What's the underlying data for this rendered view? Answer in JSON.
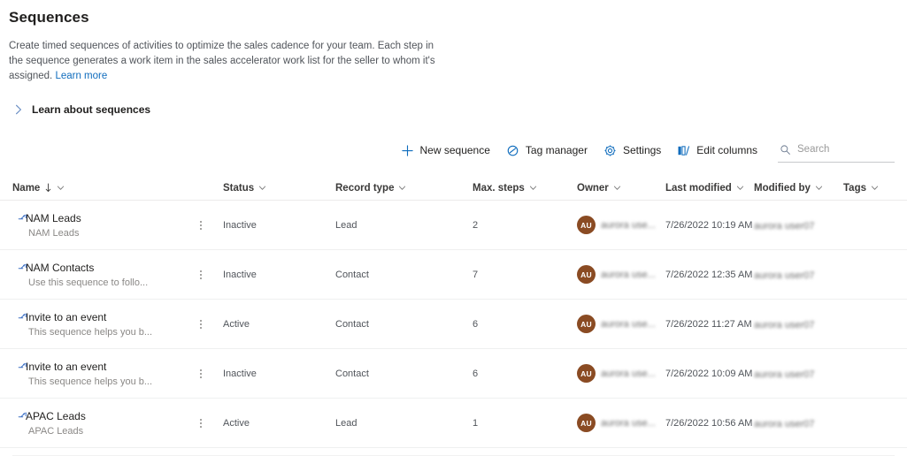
{
  "header": {
    "title": "Sequences",
    "description_part1": "Create timed sequences of activities to optimize the sales cadence for your team. Each step in the sequence generates a work item in the sales accelerator work list for the seller to whom it's assigned. ",
    "learn_more_link": "Learn more",
    "learn_about_label": "Learn about sequences",
    "chevron_icon": "chevron-right-icon"
  },
  "toolbar": {
    "new_sequence_label": "New sequence",
    "new_sequence_icon": "plus-icon",
    "tag_manager_label": "Tag manager",
    "tag_manager_icon": "tag-icon",
    "settings_label": "Settings",
    "settings_icon": "gear-icon",
    "edit_columns_label": "Edit columns",
    "edit_columns_icon": "columns-icon",
    "search_placeholder": "Search",
    "search_value": "",
    "search_icon": "search-icon"
  },
  "grid": {
    "columns": [
      {
        "label": "Name",
        "sorted": true,
        "sort_icon": "sort-descending-icon"
      },
      {
        "label": "Status",
        "sorted": false
      },
      {
        "label": "Record type",
        "sorted": false
      },
      {
        "label": "Max. steps",
        "sorted": false
      },
      {
        "label": "Owner",
        "sorted": false
      },
      {
        "label": "Last modified",
        "sorted": false
      },
      {
        "label": "Modified by",
        "sorted": false
      },
      {
        "label": "Tags",
        "sorted": false
      }
    ],
    "rows": [
      {
        "name": "NAM Leads",
        "subtitle": "NAM Leads",
        "status": "Inactive",
        "record_type": "Lead",
        "max_steps": "2",
        "owner_initials": "AU",
        "owner_name": "aurora use...",
        "last_modified": "7/26/2022 10:19 AM",
        "modified_by": "aurora user07",
        "tags": ""
      },
      {
        "name": "NAM Contacts",
        "subtitle": "Use this sequence to follo...",
        "status": "Inactive",
        "record_type": "Contact",
        "max_steps": "7",
        "owner_initials": "AU",
        "owner_name": "aurora use...",
        "last_modified": "7/26/2022 12:35 AM",
        "modified_by": "aurora user07",
        "tags": ""
      },
      {
        "name": "Invite to an event",
        "subtitle": "This sequence helps you b...",
        "status": "Active",
        "record_type": "Contact",
        "max_steps": "6",
        "owner_initials": "AU",
        "owner_name": "aurora use...",
        "last_modified": "7/26/2022 11:27 AM",
        "modified_by": "aurora user07",
        "tags": ""
      },
      {
        "name": "Invite to an event",
        "subtitle": "This sequence helps you b...",
        "status": "Inactive",
        "record_type": "Contact",
        "max_steps": "6",
        "owner_initials": "AU",
        "owner_name": "aurora use...",
        "last_modified": "7/26/2022 10:09 AM",
        "modified_by": "aurora user07",
        "tags": ""
      },
      {
        "name": "APAC Leads",
        "subtitle": "APAC Leads",
        "status": "Active",
        "record_type": "Lead",
        "max_steps": "1",
        "owner_initials": "AU",
        "owner_name": "aurora use...",
        "last_modified": "7/26/2022 10:56 AM",
        "modified_by": "aurora user07",
        "tags": ""
      }
    ],
    "row_icon": "sequence-icon",
    "row_menu_icon": "more-vertical-icon"
  },
  "colors": {
    "accent": "#0f6cbd",
    "link": "#0f6cbd",
    "avatar_bg": "#8a4b23",
    "text": "#201f1e",
    "muted": "#8a8886"
  }
}
